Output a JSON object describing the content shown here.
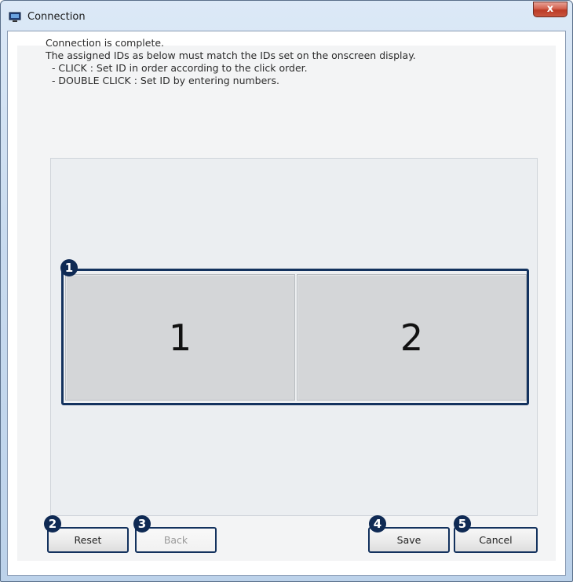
{
  "window": {
    "title": "Connection",
    "close_label": "x"
  },
  "instructions": [
    "Connection is complete.",
    "The assigned IDs as below must match the IDs set on the onscreen display.",
    "  - CLICK : Set ID in order according to the click order.",
    "  - DOUBLE CLICK : Set ID by entering numbers."
  ],
  "displays": [
    {
      "id_label": "1"
    },
    {
      "id_label": "2"
    }
  ],
  "callouts": [
    "1",
    "2",
    "3",
    "4",
    "5"
  ],
  "buttons": {
    "reset": "Reset",
    "back": "Back",
    "save": "Save",
    "cancel": "Cancel"
  },
  "colors": {
    "callout": "#0f2a54",
    "selection_border": "#13325e",
    "display_fill": "#d4d6d8"
  }
}
